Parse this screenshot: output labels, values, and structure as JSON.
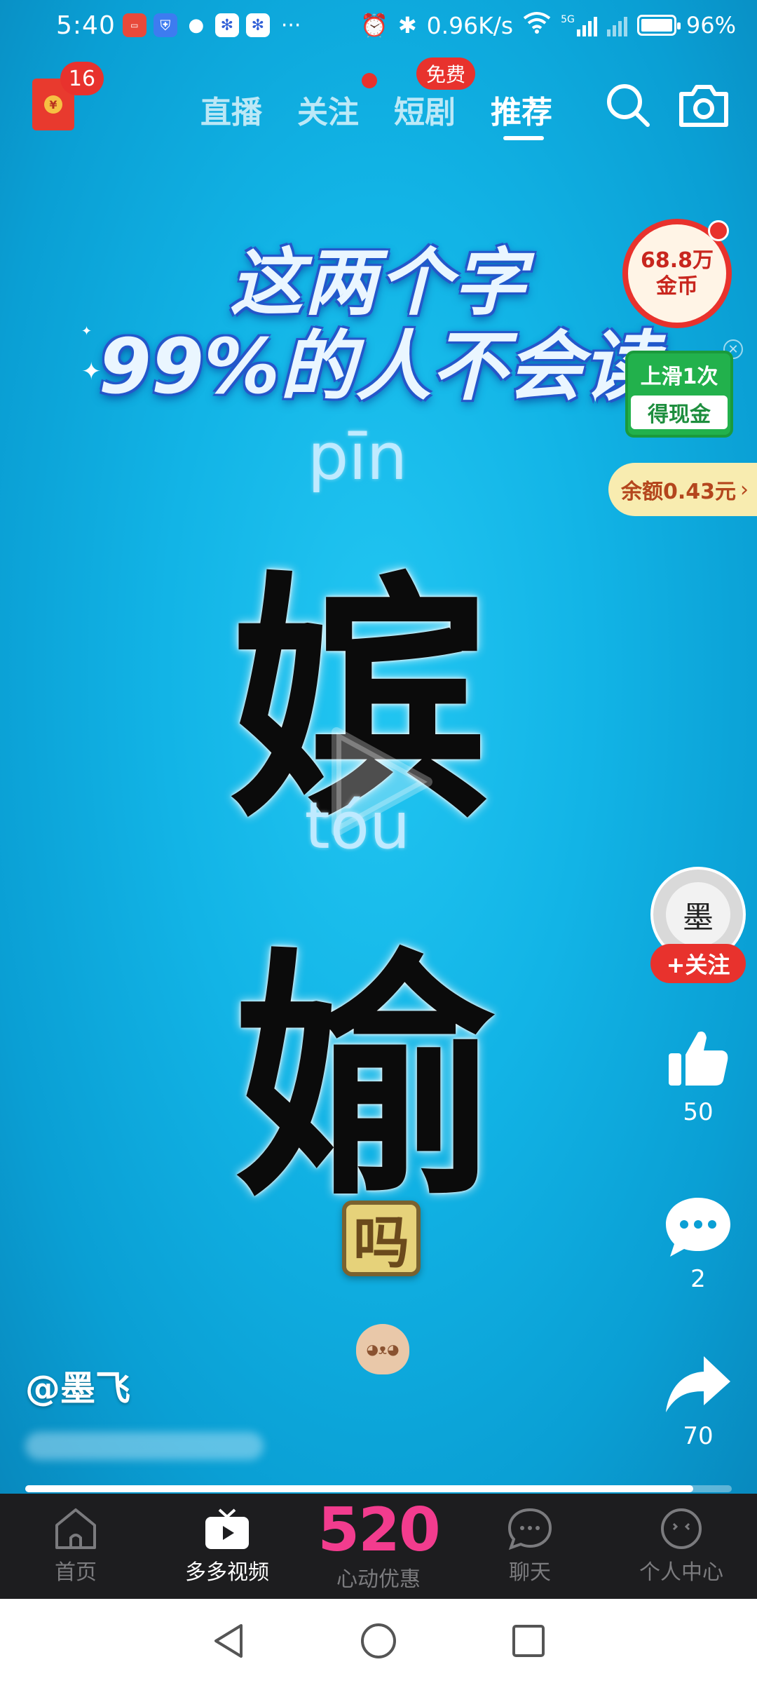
{
  "status_bar": {
    "time": "5:40",
    "dots": "···",
    "net_speed": "0.96K/s",
    "network_type": "5G",
    "battery": "96%",
    "mini_apps": [
      "huawei-app-icon",
      "shield-app-icon",
      "wechat-icon",
      "baidu-icon",
      "baidu-icon"
    ]
  },
  "top_nav": {
    "redpack_count": "16",
    "tabs": [
      "直播",
      "关注",
      "短剧",
      "推荐"
    ],
    "active_tab": "推荐",
    "drama_badge": "免费"
  },
  "video": {
    "headline_1": "这两个字",
    "headline_2": "99%的人不会读",
    "pinyin_1": "pīn",
    "char_1": "嫔",
    "pinyin_2": "tóu",
    "char_2": "媮",
    "question_char": "吗"
  },
  "side": {
    "coin_amount": "68.8万",
    "coin_label": "金币",
    "swipe_line1": "上滑1次",
    "swipe_line2": "得现金",
    "balance": "余额0.43元",
    "avatar_char": "墨",
    "follow_label": "+关注",
    "likes": "50",
    "comments": "2",
    "shares": "70"
  },
  "caption": {
    "author": "@墨飞",
    "progress": 0.945
  },
  "bottom_tabs": {
    "home": "首页",
    "video": "多多视频",
    "promo_big": "520",
    "promo_sub": "心动优惠",
    "chat": "聊天",
    "profile": "个人中心"
  },
  "colors": {
    "accent_red": "#e8322d",
    "promo_pink": "#f23c8e",
    "video_bg": "#12b4e6",
    "tab_bar_bg": "#1d1d1f"
  }
}
